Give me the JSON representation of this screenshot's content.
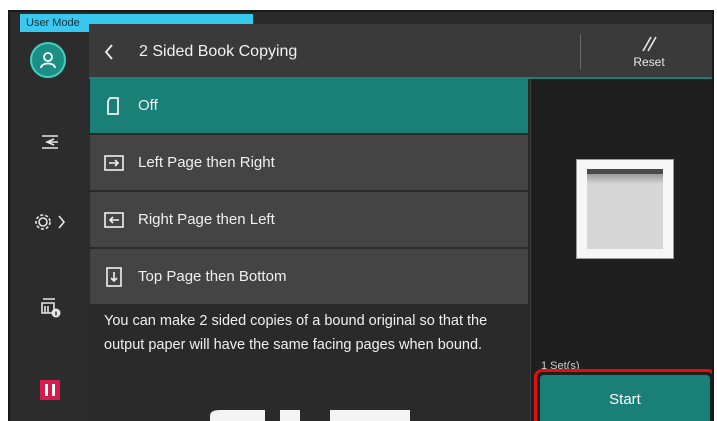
{
  "mode_tab": {
    "label": "User Mode"
  },
  "header": {
    "title": "2 Sided Book Copying",
    "reset_label": "Reset"
  },
  "options": [
    {
      "label": "Off",
      "icon": "single-page-icon",
      "selected": true
    },
    {
      "label": "Left Page then Right",
      "icon": "left-right-page-icon",
      "selected": false
    },
    {
      "label": "Right Page then Left",
      "icon": "right-left-page-icon",
      "selected": false
    },
    {
      "label": "Top Page then Bottom",
      "icon": "top-bottom-page-icon",
      "selected": false
    }
  ],
  "description": "You can make 2 sided copies of a bound original so that the output paper will have the same facing pages when bound.",
  "right_panel": {
    "sets": "1 Set(s)",
    "start_label": "Start"
  },
  "colors": {
    "accent": "#1a7f76",
    "highlight": "#e01010",
    "mode_tab": "#39c9ef",
    "pause": "#d61b4e"
  }
}
